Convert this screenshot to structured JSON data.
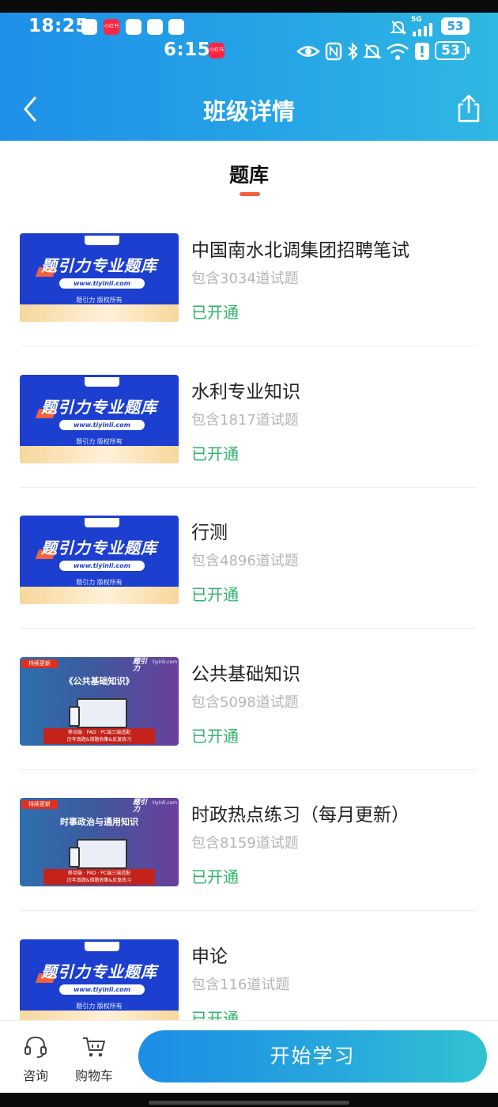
{
  "status_bar_outer": {
    "time": "18:25",
    "network": "5G",
    "battery": "53",
    "app_tag": "小红书"
  },
  "status_bar_inner": {
    "time": "6:15",
    "battery": "53",
    "app_tag": "小红书"
  },
  "nav": {
    "title": "班级详情",
    "back_icon": "chevron-left-icon",
    "share_icon": "share-icon"
  },
  "tabs": [
    {
      "label": "题库",
      "active": true
    }
  ],
  "thumbnail_text": {
    "banner": "题引力专业题库",
    "url": "www.tiyinli.com",
    "copyright": "题引力 版权所有",
    "brand": "题引力",
    "badge": "持续更新",
    "site": "tiyinli.com",
    "logo": "题引力",
    "tag_line_1": "移动端 · PAD · PC端三端适配",
    "tag_line_2": "历年真题&错题收集&反复练习",
    "heading_public": "《公共基础知识》",
    "heading_politics": "时事政治与通用知识"
  },
  "courses": [
    {
      "title": "中国南水北调集团招聘笔试",
      "count": "包含3034道试题",
      "status": "已开通",
      "thumb": "A"
    },
    {
      "title": "水利专业知识",
      "count": "包含1817道试题",
      "status": "已开通",
      "thumb": "A"
    },
    {
      "title": "行测",
      "count": "包含4896道试题",
      "status": "已开通",
      "thumb": "A"
    },
    {
      "title": "公共基础知识",
      "count": "包含5098道试题",
      "status": "已开通",
      "thumb": "B1"
    },
    {
      "title": "时政热点练习（每月更新）",
      "count": "包含8159道试题",
      "status": "已开通",
      "thumb": "B2"
    },
    {
      "title": "申论",
      "count": "包含116道试题",
      "status": "已开通",
      "thumb": "A"
    }
  ],
  "bottom_bar": {
    "consult": "咨询",
    "cart": "购物车",
    "start": "开始学习"
  },
  "colors": {
    "header_start": "#1f8fe8",
    "header_end": "#2fb8e3",
    "tab_underline": "#f0623f",
    "status_green": "#2fb36a",
    "count_gray": "#b5b5b5"
  }
}
